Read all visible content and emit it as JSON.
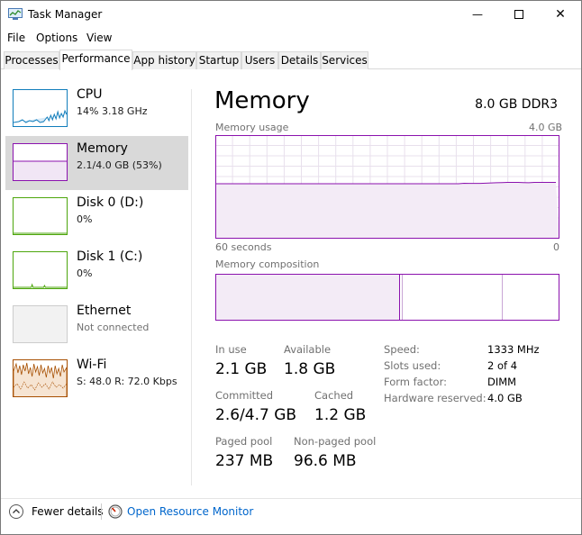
{
  "window": {
    "title": "Task Manager",
    "min_glyph": "—",
    "max_glyph": "☐",
    "close_glyph": "✕"
  },
  "menu": [
    "File",
    "Options",
    "View"
  ],
  "tabs": [
    {
      "label": "Processes",
      "active": false
    },
    {
      "label": "Performance",
      "active": true
    },
    {
      "label": "App history",
      "active": false
    },
    {
      "label": "Startup",
      "active": false
    },
    {
      "label": "Users",
      "active": false
    },
    {
      "label": "Details",
      "active": false
    },
    {
      "label": "Services",
      "active": false
    }
  ],
  "sidebar": {
    "items": [
      {
        "name": "CPU",
        "sub": "14%  3.18 GHz",
        "color": "#117dbb",
        "selected": false
      },
      {
        "name": "Memory",
        "sub": "2.1/4.0 GB (53%)",
        "color": "#8b12ae",
        "selected": true
      },
      {
        "name": "Disk 0 (D:)",
        "sub": "0%",
        "color": "#4da60c",
        "selected": false
      },
      {
        "name": "Disk 1 (C:)",
        "sub": "0%",
        "color": "#4da60c",
        "selected": false
      },
      {
        "name": "Ethernet",
        "sub": "Not connected",
        "color": "#cccccc",
        "selected": false
      },
      {
        "name": "Wi-Fi",
        "sub": "S: 48.0  R: 72.0 Kbps",
        "color": "#a74f01",
        "selected": false
      }
    ]
  },
  "main": {
    "title": "Memory",
    "spec": "8.0 GB DDR3",
    "usage_label": "Memory usage",
    "usage_max": "4.0 GB",
    "time_label": "60 seconds",
    "time_end": "0",
    "composition_label": "Memory composition",
    "usage_fraction": 0.53,
    "stats": {
      "in_use_label": "In use",
      "in_use": "2.1 GB",
      "available_label": "Available",
      "available": "1.8 GB",
      "committed_label": "Committed",
      "committed": "2.6/4.7 GB",
      "cached_label": "Cached",
      "cached": "1.2 GB",
      "paged_label": "Paged pool",
      "paged": "237 MB",
      "nonpaged_label": "Non-paged pool",
      "nonpaged": "96.6 MB"
    },
    "specs": [
      {
        "key": "Speed:",
        "value": "1333 MHz"
      },
      {
        "key": "Slots used:",
        "value": "2 of 4"
      },
      {
        "key": "Form factor:",
        "value": "DIMM"
      },
      {
        "key": "Hardware reserved:",
        "value": "4.0 GB"
      }
    ],
    "accent": "#8b12ae"
  },
  "footer": {
    "fewer_details": "Fewer details",
    "resource_monitor": "Open Resource Monitor"
  }
}
